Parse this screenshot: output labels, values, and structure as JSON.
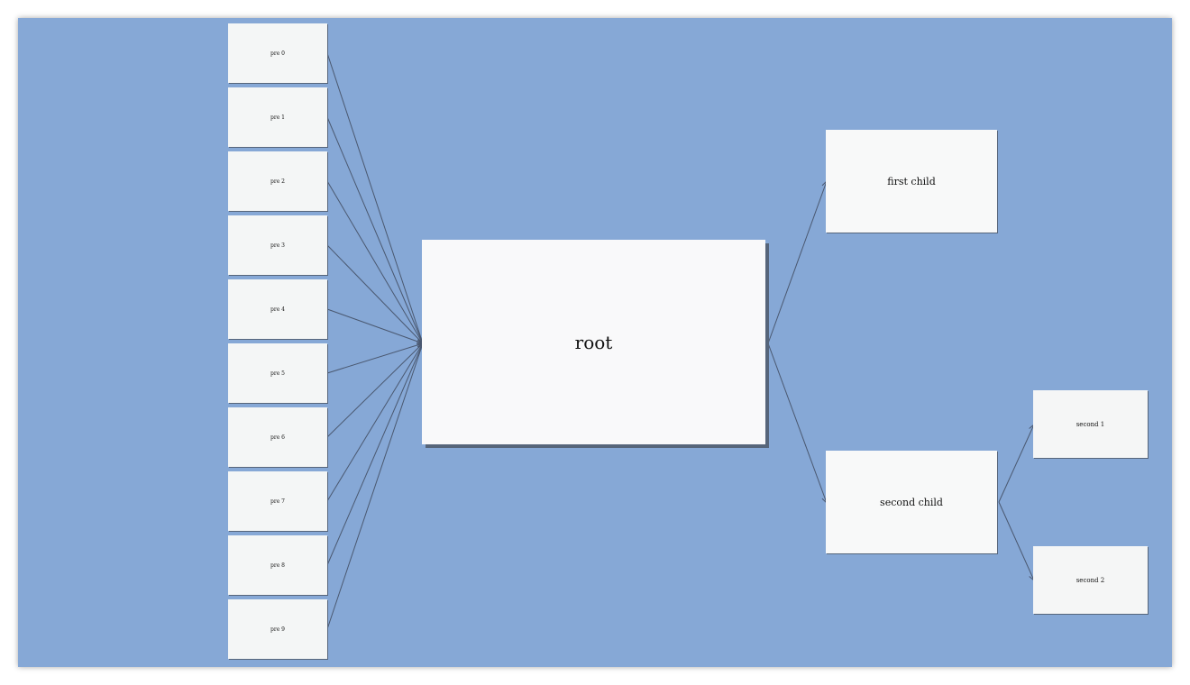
{
  "diagram": {
    "root": {
      "label": "root"
    },
    "predecessors": [
      {
        "label": "pre 0"
      },
      {
        "label": "pre 1"
      },
      {
        "label": "pre 2"
      },
      {
        "label": "pre 3"
      },
      {
        "label": "pre 4"
      },
      {
        "label": "pre 5"
      },
      {
        "label": "pre 6"
      },
      {
        "label": "pre 7"
      },
      {
        "label": "pre 8"
      },
      {
        "label": "pre 9"
      }
    ],
    "children": [
      {
        "label": "first child"
      },
      {
        "label": "second child"
      }
    ],
    "grandchildren": [
      {
        "label": "second 1"
      },
      {
        "label": "second 2"
      }
    ],
    "colors": {
      "background": "#86a8d6",
      "node": "#f8f9f9",
      "edge": "#4a5870",
      "shadow": "#56657a"
    }
  }
}
